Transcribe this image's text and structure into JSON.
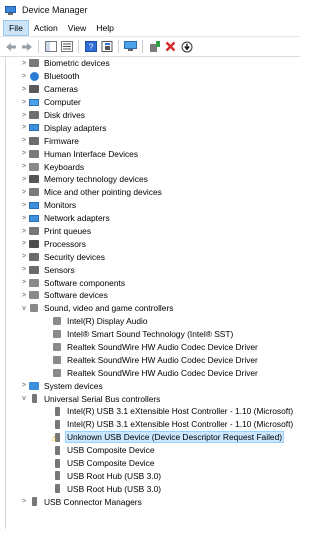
{
  "window": {
    "title": "Device Manager"
  },
  "menu": [
    "File",
    "Action",
    "View",
    "Help"
  ],
  "toolbar": [
    "back-arrow-icon",
    "forward-arrow-icon",
    "show-hide-tree-icon",
    "properties-icon",
    "help-icon",
    "help-book-icon",
    "scan-hardware-icon",
    "update-driver-icon",
    "uninstall-device-icon",
    "disable-device-icon"
  ],
  "tree": [
    {
      "level": 1,
      "expander": ">",
      "icon": "biometric-icon",
      "label": "Biometric devices"
    },
    {
      "level": 1,
      "expander": ">",
      "icon": "bluetooth-icon",
      "label": "Bluetooth"
    },
    {
      "level": 1,
      "expander": ">",
      "icon": "camera-icon",
      "label": "Cameras"
    },
    {
      "level": 1,
      "expander": ">",
      "icon": "computer-icon",
      "label": "Computer"
    },
    {
      "level": 1,
      "expander": ">",
      "icon": "disk-drive-icon",
      "label": "Disk drives"
    },
    {
      "level": 1,
      "expander": ">",
      "icon": "display-adapter-icon",
      "label": "Display adapters"
    },
    {
      "level": 1,
      "expander": ">",
      "icon": "firmware-icon",
      "label": "Firmware"
    },
    {
      "level": 1,
      "expander": ">",
      "icon": "hid-icon",
      "label": "Human Interface Devices"
    },
    {
      "level": 1,
      "expander": ">",
      "icon": "keyboard-icon",
      "label": "Keyboards"
    },
    {
      "level": 1,
      "expander": ">",
      "icon": "memory-icon",
      "label": "Memory technology devices"
    },
    {
      "level": 1,
      "expander": ">",
      "icon": "mouse-icon",
      "label": "Mice and other pointing devices"
    },
    {
      "level": 1,
      "expander": ">",
      "icon": "monitor-icon",
      "label": "Monitors"
    },
    {
      "level": 1,
      "expander": ">",
      "icon": "network-adapter-icon",
      "label": "Network adapters"
    },
    {
      "level": 1,
      "expander": ">",
      "icon": "printer-icon",
      "label": "Print queues"
    },
    {
      "level": 1,
      "expander": ">",
      "icon": "processor-icon",
      "label": "Processors"
    },
    {
      "level": 1,
      "expander": ">",
      "icon": "security-icon",
      "label": "Security devices"
    },
    {
      "level": 1,
      "expander": ">",
      "icon": "sensor-icon",
      "label": "Sensors"
    },
    {
      "level": 1,
      "expander": ">",
      "icon": "software-component-icon",
      "label": "Software components"
    },
    {
      "level": 1,
      "expander": ">",
      "icon": "software-device-icon",
      "label": "Software devices"
    },
    {
      "level": 1,
      "expander": "v",
      "icon": "sound-icon",
      "label": "Sound, video and game controllers"
    },
    {
      "level": 2,
      "expander": "",
      "icon": "audio-device-icon",
      "label": "Intel(R) Display Audio"
    },
    {
      "level": 2,
      "expander": "",
      "icon": "audio-device-icon",
      "label": "Intel® Smart Sound Technology (Intel® SST)"
    },
    {
      "level": 2,
      "expander": "",
      "icon": "audio-device-icon",
      "label": "Realtek SoundWire HW Audio Codec Device Driver"
    },
    {
      "level": 2,
      "expander": "",
      "icon": "audio-device-icon",
      "label": "Realtek SoundWire HW Audio Codec Device Driver"
    },
    {
      "level": 2,
      "expander": "",
      "icon": "audio-device-icon",
      "label": "Realtek SoundWire HW Audio Codec Device Driver"
    },
    {
      "level": 1,
      "expander": ">",
      "icon": "system-device-icon",
      "label": "System devices"
    },
    {
      "level": 1,
      "expander": "v",
      "icon": "usb-icon",
      "label": "Universal Serial Bus controllers"
    },
    {
      "level": 2,
      "expander": "",
      "icon": "usb-icon",
      "label": "Intel(R) USB 3.1 eXtensible Host Controller - 1.10 (Microsoft)"
    },
    {
      "level": 2,
      "expander": "",
      "icon": "usb-icon",
      "label": "Intel(R) USB 3.1 eXtensible Host Controller - 1.10 (Microsoft)"
    },
    {
      "level": 2,
      "expander": "",
      "icon": "usb-warning-icon",
      "label": "Unknown USB Device (Device Descriptor Request Failed)",
      "selected": true
    },
    {
      "level": 2,
      "expander": "",
      "icon": "usb-icon",
      "label": "USB Composite Device"
    },
    {
      "level": 2,
      "expander": "",
      "icon": "usb-icon",
      "label": "USB Composite Device"
    },
    {
      "level": 2,
      "expander": "",
      "icon": "usb-icon",
      "label": "USB Root Hub (USB 3.0)"
    },
    {
      "level": 2,
      "expander": "",
      "icon": "usb-icon",
      "label": "USB Root Hub (USB 3.0)"
    },
    {
      "level": 1,
      "expander": ">",
      "icon": "usb-connector-icon",
      "label": "USB Connector Managers"
    }
  ]
}
